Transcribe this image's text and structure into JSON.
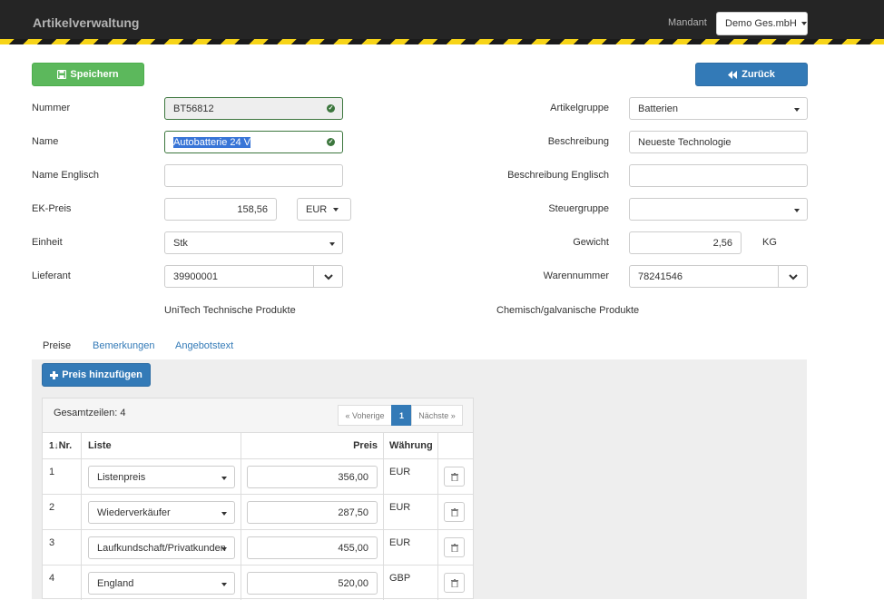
{
  "app": {
    "title": "Artikelverwaltung"
  },
  "header": {
    "mandant_label": "Mandant",
    "mandant_value": "Demo Ges.mbH"
  },
  "toolbar": {
    "save_label": "Speichern",
    "back_label": "Zurück"
  },
  "form": {
    "nummer": {
      "label": "Nummer",
      "value": "BT56812"
    },
    "name": {
      "label": "Name",
      "value": "Autobatterie 24 V"
    },
    "name_en": {
      "label": "Name Englisch",
      "value": ""
    },
    "ek_preis": {
      "label": "EK-Preis",
      "value": "158,56",
      "currency": "EUR"
    },
    "einheit": {
      "label": "Einheit",
      "value": "Stk"
    },
    "lieferant": {
      "label": "Lieferant",
      "value": "39900001",
      "description": "UniTech Technische Produkte"
    },
    "artikelgruppe": {
      "label": "Artikelgruppe",
      "value": "Batterien"
    },
    "beschreibung": {
      "label": "Beschreibung",
      "value": "Neueste Technologie"
    },
    "beschreibung_en": {
      "label": "Beschreibung Englisch",
      "value": ""
    },
    "steuergruppe": {
      "label": "Steuergruppe",
      "value": ""
    },
    "gewicht": {
      "label": "Gewicht",
      "value": "2,56",
      "unit": "KG"
    },
    "warennummer": {
      "label": "Warennummer",
      "value": "78241546",
      "description": "Chemisch/galvanische Produkte"
    }
  },
  "tabs": [
    {
      "label": "Preise",
      "active": true
    },
    {
      "label": "Bemerkungen",
      "active": false
    },
    {
      "label": "Angebotstext",
      "active": false
    }
  ],
  "prices": {
    "add_label": "Preis hinzufügen",
    "total": "Gesamtzeilen: 4",
    "pagination": {
      "prev": "« Voherige",
      "current": "1",
      "next": "Nächste »"
    },
    "columns": {
      "nr": "Nr.",
      "sort_icon_text": "1↓",
      "liste": "Liste",
      "preis": "Preis",
      "waehrung": "Währung"
    },
    "rows": [
      {
        "nr": "1",
        "liste": "Listenpreis",
        "preis": "356,00",
        "waehrung": "EUR"
      },
      {
        "nr": "2",
        "liste": "Wiederverkäufer",
        "preis": "287,50",
        "waehrung": "EUR"
      },
      {
        "nr": "3",
        "liste": "Laufkundschaft/Privatkunden",
        "preis": "455,00",
        "waehrung": "EUR"
      },
      {
        "nr": "4",
        "liste": "England",
        "preis": "520,00",
        "waehrung": "GBP"
      }
    ]
  },
  "colors": {
    "header_bg": "#252525",
    "stripe_yellow": "#f7d417",
    "success": "#5cb85c",
    "primary": "#337ab7",
    "valid_border": "#3c763d"
  },
  "icons": [
    "save-icon",
    "back-icon",
    "check-icon",
    "chevron-down-icon",
    "plus-icon",
    "sort-icon",
    "trash-icon"
  ]
}
